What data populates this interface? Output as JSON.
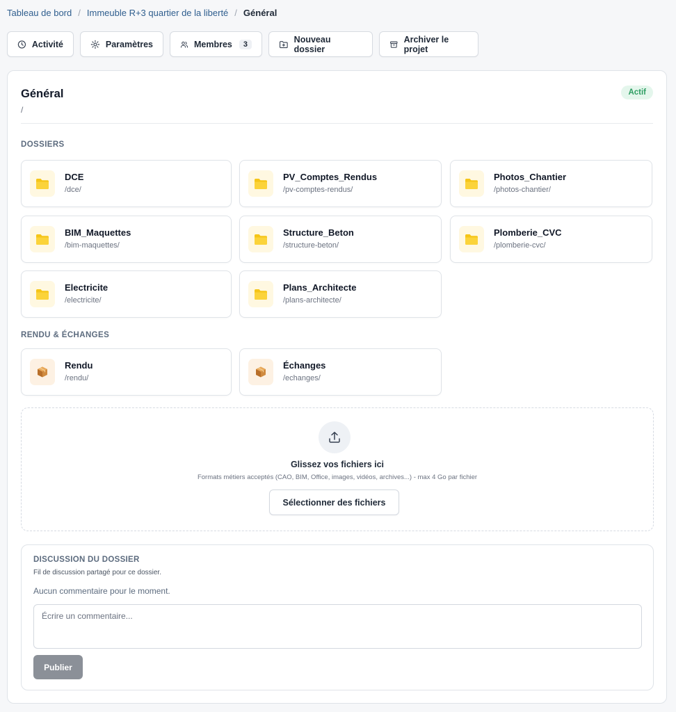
{
  "breadcrumb": {
    "items": [
      "Tableau de bord",
      "Immeuble R+3 quartier de la liberté"
    ],
    "current": "Général",
    "separator": "/"
  },
  "toolbar": {
    "activity": "Activité",
    "settings": "Paramètres",
    "members": "Membres",
    "members_count": "3",
    "new_folder": "Nouveau dossier",
    "archive": "Archiver le projet"
  },
  "folder": {
    "title": "Général",
    "path": "/",
    "status": "Actif"
  },
  "sections": {
    "folders": "DOSSIERS",
    "exchanges": "RENDU & ÉCHANGES"
  },
  "folders": [
    {
      "name": "DCE",
      "path": "/dce/",
      "icon": "folder-icon"
    },
    {
      "name": "PV_Comptes_Rendus",
      "path": "/pv-comptes-rendus/",
      "icon": "folder-icon"
    },
    {
      "name": "Photos_Chantier",
      "path": "/photos-chantier/",
      "icon": "folder-icon"
    },
    {
      "name": "BIM_Maquettes",
      "path": "/bim-maquettes/",
      "icon": "folder-icon"
    },
    {
      "name": "Structure_Beton",
      "path": "/structure-beton/",
      "icon": "folder-icon"
    },
    {
      "name": "Plomberie_CVC",
      "path": "/plomberie-cvc/",
      "icon": "folder-icon"
    },
    {
      "name": "Electricite",
      "path": "/electricite/",
      "icon": "folder-icon"
    },
    {
      "name": "Plans_Architecte",
      "path": "/plans-architecte/",
      "icon": "folder-icon"
    }
  ],
  "exchanges": [
    {
      "name": "Rendu",
      "path": "/rendu/",
      "icon": "package-icon"
    },
    {
      "name": "Échanges",
      "path": "/echanges/",
      "icon": "package-icon"
    }
  ],
  "upload": {
    "title": "Glissez vos fichiers ici",
    "hint": "Formats métiers acceptés (CAO, BIM, Office, images, vidéos, archives...) - max 4 Go par fichier",
    "button": "Sélectionner des fichiers"
  },
  "discussion": {
    "title": "DISCUSSION DU DOSSIER",
    "subtitle": "Fil de discussion partagé pour ce dossier.",
    "empty": "Aucun commentaire pour le moment.",
    "placeholder": "Écrire un commentaire...",
    "value": "",
    "publish": "Publier"
  },
  "colors": {
    "link": "#2f5e8e",
    "status_bg": "#e4f6ec",
    "status_text": "#2f9e63",
    "folder_icon": "#f5c518",
    "publish_bg": "#8b9098"
  }
}
